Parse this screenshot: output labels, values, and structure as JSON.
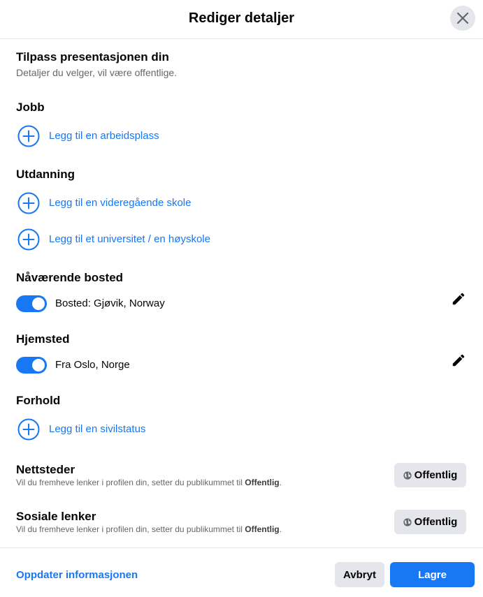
{
  "dialog": {
    "title": "Rediger detaljer",
    "close_icon": "close-icon"
  },
  "intro": {
    "title": "Tilpass presentasjonen din",
    "subtitle": "Detaljer du velger, vil være offentlige."
  },
  "work": {
    "title": "Jobb",
    "add_label": "Legg til en arbeidsplass"
  },
  "education": {
    "title": "Utdanning",
    "add_highschool": "Legg til en videregående skole",
    "add_university": "Legg til et universitet / en høyskole"
  },
  "current_city": {
    "title": "Nåværende bosted",
    "value": "Bosted: Gjøvik, Norway",
    "toggle_on": true
  },
  "hometown": {
    "title": "Hjemsted",
    "value": "Fra Oslo, Norge",
    "toggle_on": true
  },
  "relationship": {
    "title": "Forhold",
    "add_label": "Legg til en sivilstatus"
  },
  "websites": {
    "title": "Nettsteder",
    "desc_prefix": "Vil du fremheve lenker i profilen din, setter du publikummet til ",
    "desc_bold": "Offentlig",
    "desc_suffix": ".",
    "audience_label": "Offentlig"
  },
  "social_links": {
    "title": "Sosiale lenker",
    "desc_prefix": "Vil du fremheve lenker i profilen din, setter du publikummet til ",
    "desc_bold": "Offentlig",
    "desc_suffix": ".",
    "audience_label": "Offentlig"
  },
  "footer": {
    "update_link": "Oppdater informasjonen",
    "cancel_label": "Avbryt",
    "save_label": "Lagre"
  },
  "colors": {
    "accent": "#1877f2",
    "secondary_bg": "#e4e6eb",
    "muted_text": "#65676b"
  }
}
